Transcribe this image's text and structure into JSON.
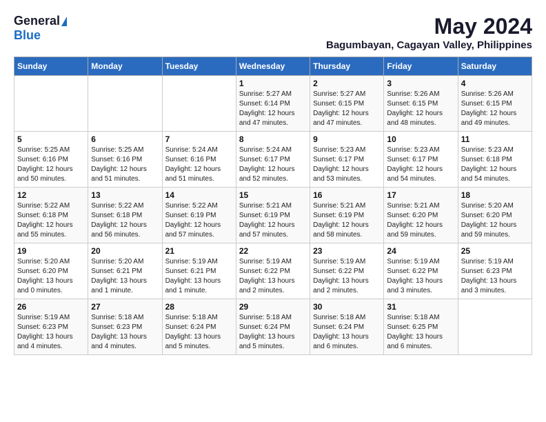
{
  "logo": {
    "general": "General",
    "blue": "Blue"
  },
  "title": {
    "month_year": "May 2024",
    "location": "Bagumbayan, Cagayan Valley, Philippines"
  },
  "calendar": {
    "headers": [
      "Sunday",
      "Monday",
      "Tuesday",
      "Wednesday",
      "Thursday",
      "Friday",
      "Saturday"
    ],
    "weeks": [
      [
        {
          "day": "",
          "info": ""
        },
        {
          "day": "",
          "info": ""
        },
        {
          "day": "",
          "info": ""
        },
        {
          "day": "1",
          "info": "Sunrise: 5:27 AM\nSunset: 6:14 PM\nDaylight: 12 hours\nand 47 minutes."
        },
        {
          "day": "2",
          "info": "Sunrise: 5:27 AM\nSunset: 6:15 PM\nDaylight: 12 hours\nand 47 minutes."
        },
        {
          "day": "3",
          "info": "Sunrise: 5:26 AM\nSunset: 6:15 PM\nDaylight: 12 hours\nand 48 minutes."
        },
        {
          "day": "4",
          "info": "Sunrise: 5:26 AM\nSunset: 6:15 PM\nDaylight: 12 hours\nand 49 minutes."
        }
      ],
      [
        {
          "day": "5",
          "info": "Sunrise: 5:25 AM\nSunset: 6:16 PM\nDaylight: 12 hours\nand 50 minutes."
        },
        {
          "day": "6",
          "info": "Sunrise: 5:25 AM\nSunset: 6:16 PM\nDaylight: 12 hours\nand 51 minutes."
        },
        {
          "day": "7",
          "info": "Sunrise: 5:24 AM\nSunset: 6:16 PM\nDaylight: 12 hours\nand 51 minutes."
        },
        {
          "day": "8",
          "info": "Sunrise: 5:24 AM\nSunset: 6:17 PM\nDaylight: 12 hours\nand 52 minutes."
        },
        {
          "day": "9",
          "info": "Sunrise: 5:23 AM\nSunset: 6:17 PM\nDaylight: 12 hours\nand 53 minutes."
        },
        {
          "day": "10",
          "info": "Sunrise: 5:23 AM\nSunset: 6:17 PM\nDaylight: 12 hours\nand 54 minutes."
        },
        {
          "day": "11",
          "info": "Sunrise: 5:23 AM\nSunset: 6:18 PM\nDaylight: 12 hours\nand 54 minutes."
        }
      ],
      [
        {
          "day": "12",
          "info": "Sunrise: 5:22 AM\nSunset: 6:18 PM\nDaylight: 12 hours\nand 55 minutes."
        },
        {
          "day": "13",
          "info": "Sunrise: 5:22 AM\nSunset: 6:18 PM\nDaylight: 12 hours\nand 56 minutes."
        },
        {
          "day": "14",
          "info": "Sunrise: 5:22 AM\nSunset: 6:19 PM\nDaylight: 12 hours\nand 57 minutes."
        },
        {
          "day": "15",
          "info": "Sunrise: 5:21 AM\nSunset: 6:19 PM\nDaylight: 12 hours\nand 57 minutes."
        },
        {
          "day": "16",
          "info": "Sunrise: 5:21 AM\nSunset: 6:19 PM\nDaylight: 12 hours\nand 58 minutes."
        },
        {
          "day": "17",
          "info": "Sunrise: 5:21 AM\nSunset: 6:20 PM\nDaylight: 12 hours\nand 59 minutes."
        },
        {
          "day": "18",
          "info": "Sunrise: 5:20 AM\nSunset: 6:20 PM\nDaylight: 12 hours\nand 59 minutes."
        }
      ],
      [
        {
          "day": "19",
          "info": "Sunrise: 5:20 AM\nSunset: 6:20 PM\nDaylight: 13 hours\nand 0 minutes."
        },
        {
          "day": "20",
          "info": "Sunrise: 5:20 AM\nSunset: 6:21 PM\nDaylight: 13 hours\nand 1 minute."
        },
        {
          "day": "21",
          "info": "Sunrise: 5:19 AM\nSunset: 6:21 PM\nDaylight: 13 hours\nand 1 minute."
        },
        {
          "day": "22",
          "info": "Sunrise: 5:19 AM\nSunset: 6:22 PM\nDaylight: 13 hours\nand 2 minutes."
        },
        {
          "day": "23",
          "info": "Sunrise: 5:19 AM\nSunset: 6:22 PM\nDaylight: 13 hours\nand 2 minutes."
        },
        {
          "day": "24",
          "info": "Sunrise: 5:19 AM\nSunset: 6:22 PM\nDaylight: 13 hours\nand 3 minutes."
        },
        {
          "day": "25",
          "info": "Sunrise: 5:19 AM\nSunset: 6:23 PM\nDaylight: 13 hours\nand 3 minutes."
        }
      ],
      [
        {
          "day": "26",
          "info": "Sunrise: 5:19 AM\nSunset: 6:23 PM\nDaylight: 13 hours\nand 4 minutes."
        },
        {
          "day": "27",
          "info": "Sunrise: 5:18 AM\nSunset: 6:23 PM\nDaylight: 13 hours\nand 4 minutes."
        },
        {
          "day": "28",
          "info": "Sunrise: 5:18 AM\nSunset: 6:24 PM\nDaylight: 13 hours\nand 5 minutes."
        },
        {
          "day": "29",
          "info": "Sunrise: 5:18 AM\nSunset: 6:24 PM\nDaylight: 13 hours\nand 5 minutes."
        },
        {
          "day": "30",
          "info": "Sunrise: 5:18 AM\nSunset: 6:24 PM\nDaylight: 13 hours\nand 6 minutes."
        },
        {
          "day": "31",
          "info": "Sunrise: 5:18 AM\nSunset: 6:25 PM\nDaylight: 13 hours\nand 6 minutes."
        },
        {
          "day": "",
          "info": ""
        }
      ]
    ]
  }
}
